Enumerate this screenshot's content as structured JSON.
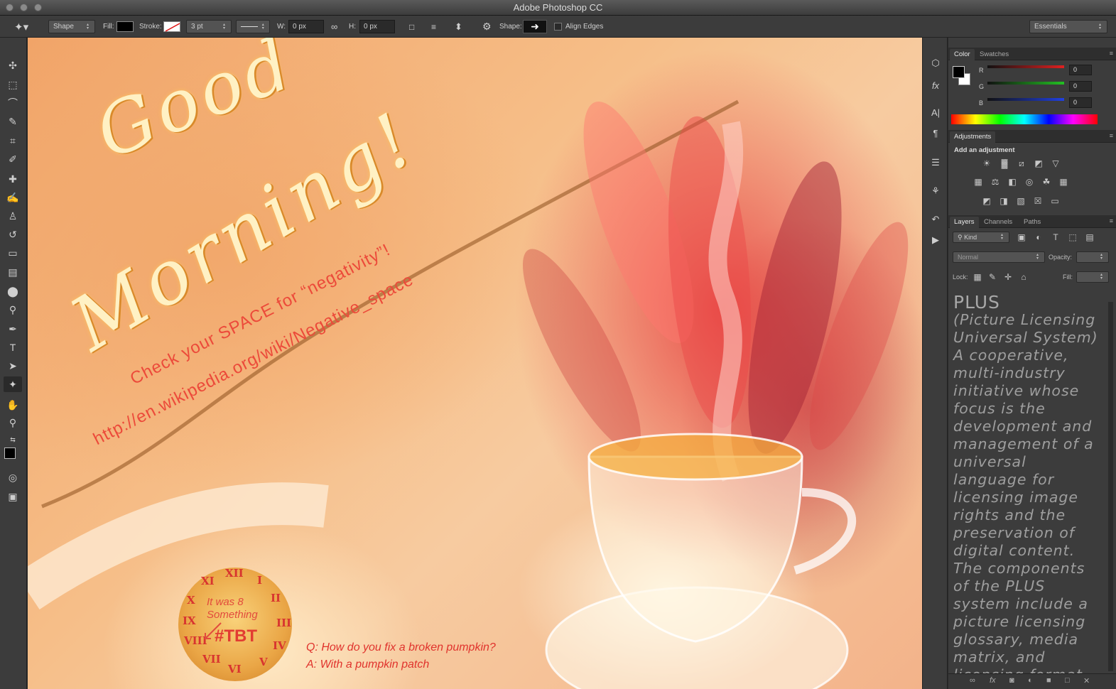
{
  "window": {
    "title": "Adobe Photoshop CC"
  },
  "options_bar": {
    "mode": "Shape",
    "fill_label": "Fill:",
    "stroke_label": "Stroke:",
    "stroke_width": "3 pt",
    "w_label": "W:",
    "w_value": "0 px",
    "h_label": "H:",
    "h_value": "0 px",
    "shape_label": "Shape:",
    "align_edges": "Align Edges",
    "workspace": "Essentials"
  },
  "canvas": {
    "headline_1": "Good",
    "headline_2": "Morning!",
    "check_line": "Check your SPACE for “negativity”!",
    "url_line": "http://en.wikipedia.org/wiki/Negative_space",
    "clock_text_1": "It was 8",
    "clock_text_2": "Something",
    "hashtag": "#TBT",
    "numerals": [
      "XII",
      "I",
      "II",
      "III",
      "IV",
      "V",
      "VI",
      "VII",
      "VIII",
      "IX",
      "X",
      "XI"
    ],
    "question": "Q: How do you fix a broken pumpkin?",
    "answer": "A: With a pumpkin patch"
  },
  "color_panel": {
    "tabs": [
      "Color",
      "Swatches"
    ],
    "r_label": "R",
    "r_value": "0",
    "g_label": "G",
    "g_value": "0",
    "b_label": "B",
    "b_value": "0"
  },
  "adjustments_panel": {
    "tab": "Adjustments",
    "heading": "Add an adjustment"
  },
  "layers_panel": {
    "tabs": [
      "Layers",
      "Channels",
      "Paths"
    ],
    "filter": "Kind",
    "blend_mode": "Normal",
    "opacity_label": "Opacity:",
    "lock_label": "Lock:",
    "fill_label": "Fill:"
  },
  "document_text": {
    "title": "PLUS",
    "body": "(Picture Licensing Universal System) A cooperative, multi-industry initiative whose focus is the development and management of a universal language for licensing image rights and the preservation of digital content. The components of the PLUS system include a picture licensing glossary, media matrix, and licensing format."
  },
  "colors": {
    "accent_red": "#ec4a3a",
    "ui_dark": "#3c3c3c",
    "r_slider": "#e02020",
    "g_slider": "#22c022",
    "b_slider": "#2040e0"
  }
}
